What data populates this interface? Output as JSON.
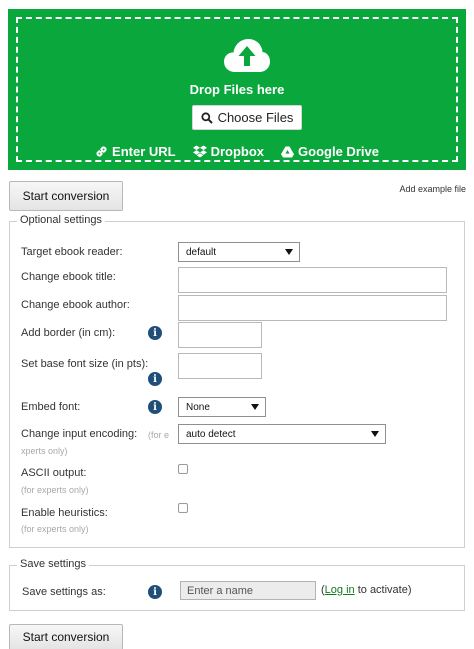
{
  "upload": {
    "drop_text": "Drop Files here",
    "choose_label": "Choose Files",
    "sources": [
      {
        "label": "Enter URL",
        "icon": "link-icon"
      },
      {
        "label": "Dropbox",
        "icon": "dropbox-icon"
      },
      {
        "label": "Google Drive",
        "icon": "google-drive-icon"
      }
    ],
    "color": "#0aa73c"
  },
  "actions": {
    "start_conversion": "Start conversion",
    "add_example_file": "Add example file"
  },
  "optional_settings": {
    "legend": "Optional settings",
    "target_reader": {
      "label": "Target ebook reader:",
      "value": "default"
    },
    "title": {
      "label": "Change ebook title:",
      "value": ""
    },
    "author": {
      "label": "Change ebook author:",
      "value": ""
    },
    "border": {
      "label": "Add border (in cm):",
      "value": ""
    },
    "base_font": {
      "label": "Set base font size (in pts):",
      "value": ""
    },
    "embed_font": {
      "label": "Embed font:",
      "value": "None"
    },
    "input_encoding": {
      "label": "Change input encoding:",
      "note_part1": "(for e",
      "note_part2": "xperts only)",
      "value": "auto detect"
    },
    "ascii_output": {
      "label": "ASCII output:",
      "note": "(for experts only)",
      "checked": false
    },
    "heuristics": {
      "label": "Enable heuristics:",
      "note": "(for experts only)",
      "checked": false
    }
  },
  "save_settings": {
    "legend": "Save settings",
    "label": "Save settings as:",
    "placeholder": "Enter a name",
    "paren_open": "(",
    "login_link": "Log in",
    "suffix": " to activate)"
  }
}
